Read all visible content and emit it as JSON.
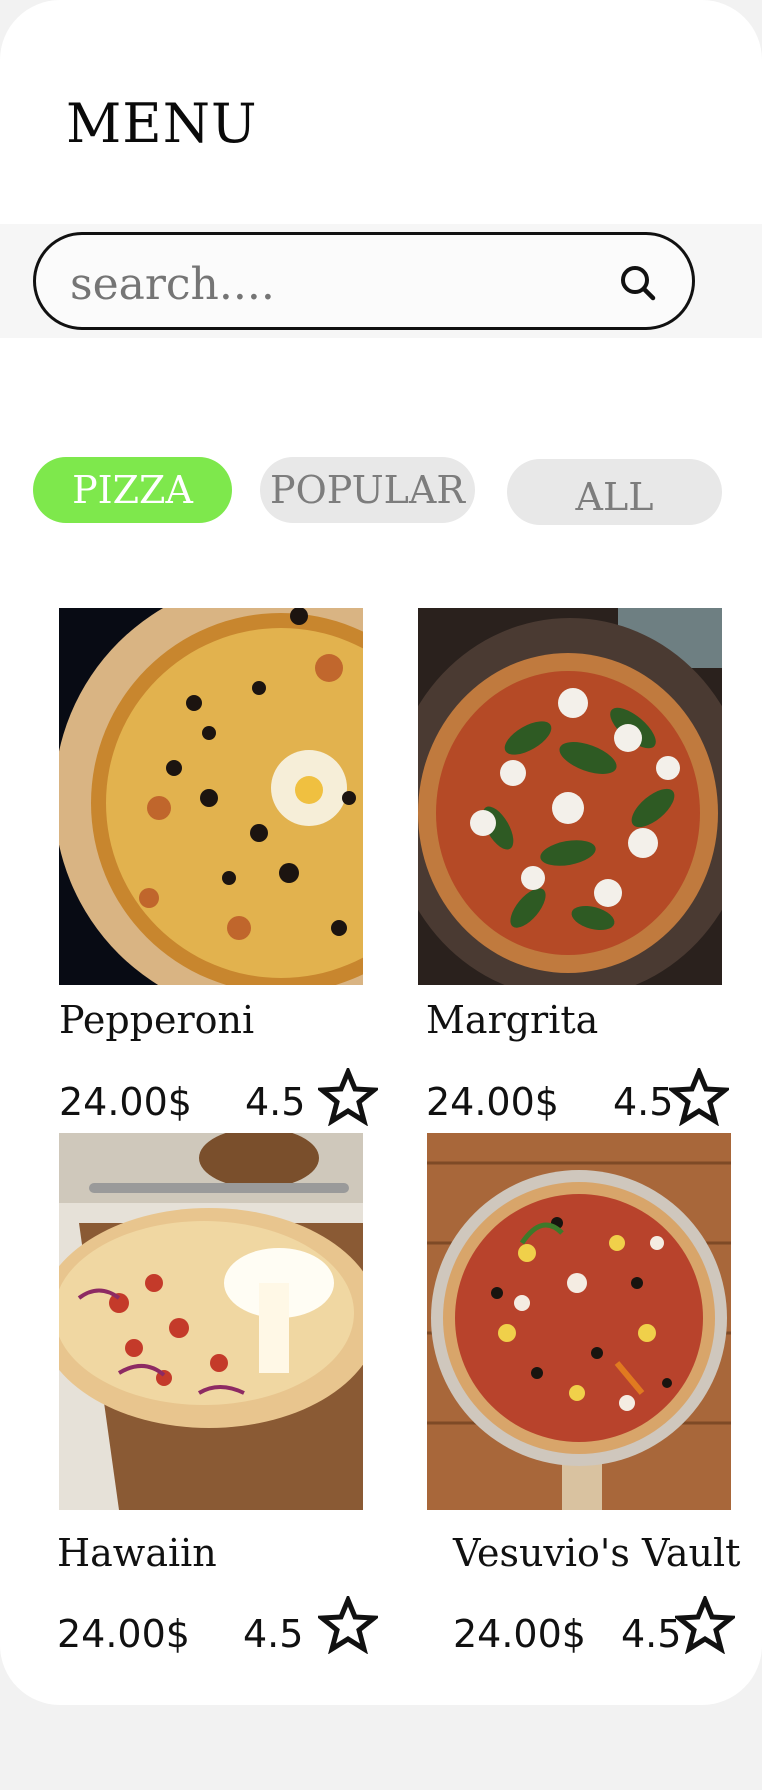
{
  "header": {
    "title": "MENU"
  },
  "search": {
    "placeholder": "search...."
  },
  "tabs": [
    {
      "label": "PIZZA",
      "active": true
    },
    {
      "label": "POPULAR",
      "active": false
    },
    {
      "label": "ALL",
      "active": false
    }
  ],
  "colors": {
    "accent": "#7ee84c",
    "inactive_tab": "#e8e8e8",
    "card": "#ffffff",
    "background": "#f2f2f2"
  },
  "products": [
    {
      "name": "Pepperoni",
      "price": "24.00$",
      "rating": "4.5",
      "icon": "star-outline-icon"
    },
    {
      "name": "Margrita",
      "price": "24.00$",
      "rating": "4.5",
      "icon": "star-outline-icon"
    },
    {
      "name": "Hawaiin",
      "price": "24.00$",
      "rating": "4.5",
      "icon": "star-outline-icon"
    },
    {
      "name": "Vesuvio's Vault",
      "price": "24.00$",
      "rating": "4.5",
      "icon": "star-outline-icon"
    }
  ]
}
